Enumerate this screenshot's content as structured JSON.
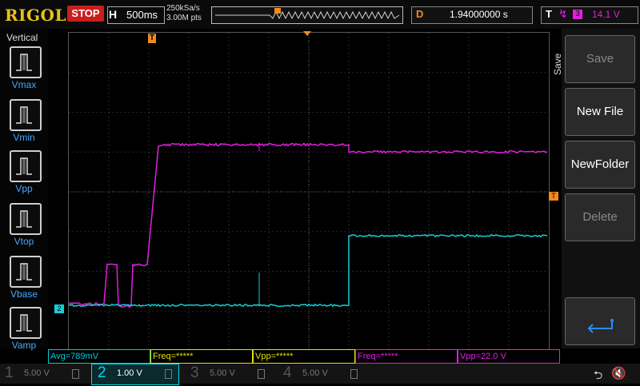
{
  "header": {
    "brand": "RIGOL",
    "run_state": "STOP",
    "horizontal_label": "H",
    "timebase": "500ms",
    "sample_rate": "250kSa/s",
    "memory_depth": "3.00M pts",
    "delay_label": "D",
    "delay_value": "1.94000000 s",
    "trigger_label": "T",
    "trigger_source": "3",
    "trigger_level": "14.1 V"
  },
  "vertical_menu": {
    "title": "Vertical",
    "items": [
      "Vmax",
      "Vmin",
      "Vpp",
      "Vtop",
      "Vbase",
      "Vamp"
    ]
  },
  "right_menu": {
    "title": "Save",
    "items": [
      "Save",
      "New File",
      "NewFolder",
      "Delete"
    ]
  },
  "markers": {
    "trigger_pos": "T",
    "channel2_ref": "2",
    "trigger_level_marker": "T"
  },
  "measurements": [
    {
      "text": "Avg=789mV",
      "color": "#00c8d8"
    },
    {
      "text": "Freq=*****",
      "color": "#e8e000"
    },
    {
      "text": "Vpp=*****",
      "color": "#e8e000"
    },
    {
      "text": "Freq=*****",
      "color": "#e020e0"
    },
    {
      "text": "Vpp=22.0 V",
      "color": "#e020e0"
    }
  ],
  "channels": [
    {
      "num": "1",
      "scale": "5.00 V",
      "color": "#e8e000",
      "active": false
    },
    {
      "num": "2",
      "scale": "1.00 V",
      "color": "#00d8e8",
      "active": true
    },
    {
      "num": "3",
      "scale": "5.00 V",
      "color": "#e020e0",
      "active": false
    },
    {
      "num": "4",
      "scale": "5.00 V",
      "color": "#2060ff",
      "active": false
    }
  ],
  "colors": {
    "ch3_trace": "#e020e0",
    "ch2_trace": "#10d0d8",
    "accent": "#f08a20"
  }
}
